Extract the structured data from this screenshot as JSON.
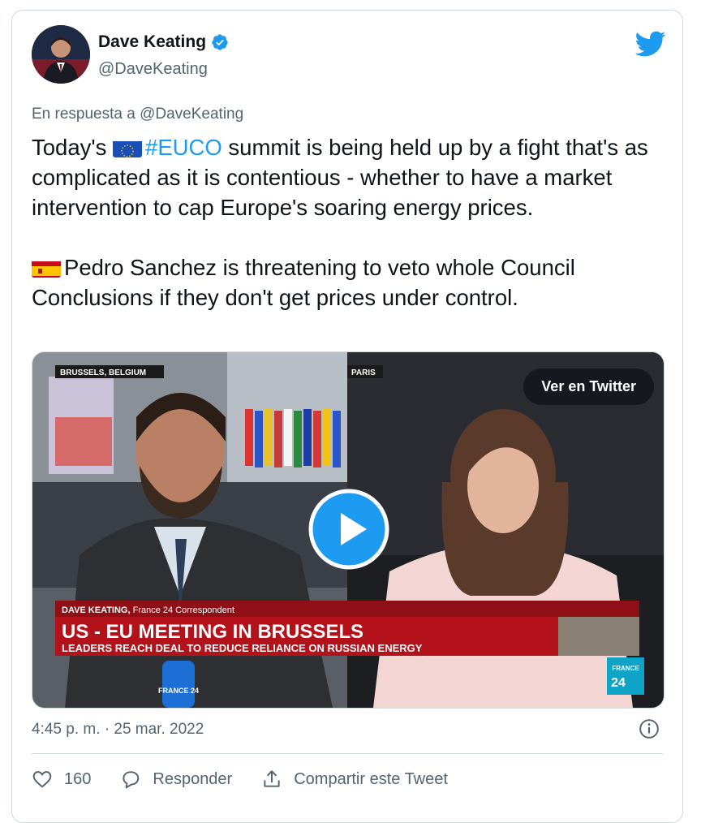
{
  "author": {
    "name": "Dave Keating",
    "handle": "@DaveKeating"
  },
  "reply_to": {
    "prefix": "En respuesta a",
    "mention": "@DaveKeating"
  },
  "tweet": {
    "p1_before": "Today's ",
    "p1_hashtag": "#EUCO",
    "p1_after": " summit is being held up by a fight that's as complicated as it is contentious - whether to have a market intervention to cap Europe's soaring energy prices.",
    "p2": "Pedro Sanchez is threatening to veto whole Council Conclusions if they don't get prices under control."
  },
  "media": {
    "view_button": "Ver en Twitter",
    "left_location": "BRUSSELS, BELGIUM",
    "right_location": "PARIS",
    "lower_third_name": "DAVE KEATING,",
    "lower_third_role": " France 24 Correspondent",
    "headline": "US - EU MEETING IN BRUSSELS",
    "subheadline": "LEADERS REACH DEAL TO REDUCE RELIANCE ON RUSSIAN ENERGY",
    "channel_logo_top": "FRANCE",
    "channel_logo_num": "24",
    "mic_text": "FRANCE 24"
  },
  "timestamp": "4:45 p. m. · 25 mar. 2022",
  "actions": {
    "likes": "160",
    "reply": "Responder",
    "share": "Compartir este Tweet"
  },
  "colors": {
    "link": "#1d9bf0",
    "secondary_text": "#536471",
    "border": "#cfd9de",
    "france24_red": "#b3121b"
  }
}
